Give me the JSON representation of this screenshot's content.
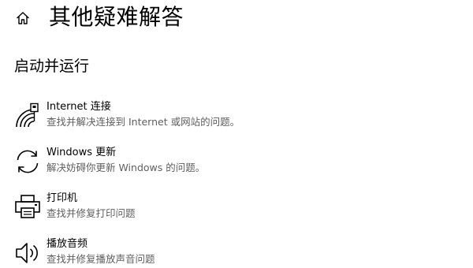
{
  "header": {
    "title": "其他疑难解答",
    "home_icon": "home-icon"
  },
  "section": {
    "title": "启动并运行"
  },
  "items": [
    {
      "icon": "wifi-network-icon",
      "title": "Internet 连接",
      "description": "查找并解决连接到 Internet 或网站的问题。"
    },
    {
      "icon": "sync-update-icon",
      "title": "Windows 更新",
      "description": "解决妨碍你更新 Windows 的问题。"
    },
    {
      "icon": "printer-icon",
      "title": "打印机",
      "description": "查找并修复打印问题"
    },
    {
      "icon": "speaker-icon",
      "title": "播放音频",
      "description": "查找并修复播放声音问题"
    }
  ]
}
